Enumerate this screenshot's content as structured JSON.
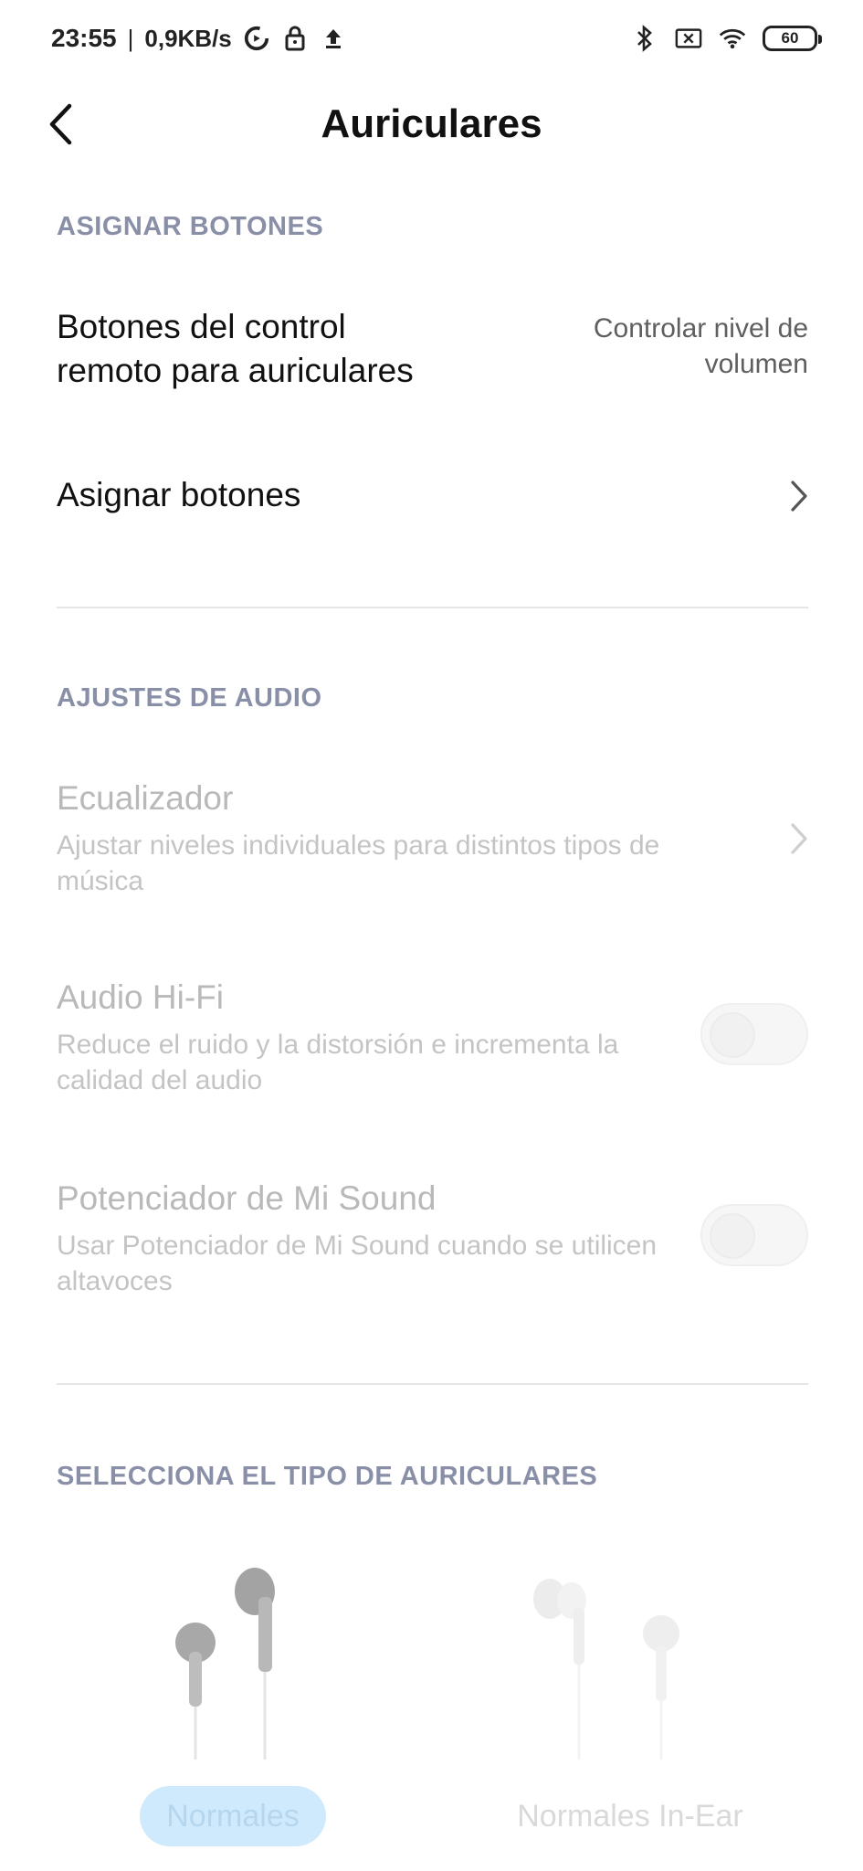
{
  "status_bar": {
    "time": "23:55",
    "separator": "|",
    "speed": "0,9KB/s",
    "battery": "60",
    "icons_left": [
      "data-saver-icon",
      "lock-icon",
      "upload-icon"
    ],
    "icons_right": [
      "bluetooth-icon",
      "no-sim-icon",
      "wifi-icon",
      "battery-icon"
    ]
  },
  "header": {
    "title": "Auriculares",
    "back_icon": "chevron-left-icon"
  },
  "section_buttons": {
    "header": "ASIGNAR BOTONES",
    "remote_row": {
      "title_line1": "Botones del control",
      "title_line2": "remoto para auriculares",
      "value_line1": "Controlar nivel de",
      "value_line2": "volumen"
    },
    "assign_row": {
      "title": "Asignar botones"
    }
  },
  "section_audio": {
    "header": "AJUSTES DE AUDIO",
    "equalizer": {
      "title": "Ecualizador",
      "subtitle": "Ajustar niveles individuales para distintos tipos de música"
    },
    "hifi": {
      "title": "Audio Hi-Fi",
      "subtitle": "Reduce el ruido y la distorsión e incrementa la calidad del audio",
      "enabled": false
    },
    "mi_sound": {
      "title": "Potenciador de Mi Sound",
      "subtitle": "Usar Potenciador de Mi Sound cuando se utilicen altavoces",
      "enabled": false
    }
  },
  "section_type": {
    "header": "SELECCIONA EL TIPO DE AURICULARES",
    "options": [
      {
        "label": "Normales",
        "selected": true
      },
      {
        "label": "Normales In-Ear",
        "selected": false
      }
    ]
  },
  "colors": {
    "section_header": "#8a8fa8",
    "selected_pill": "#cfeafd",
    "disabled_text": "#b9b9b9"
  }
}
